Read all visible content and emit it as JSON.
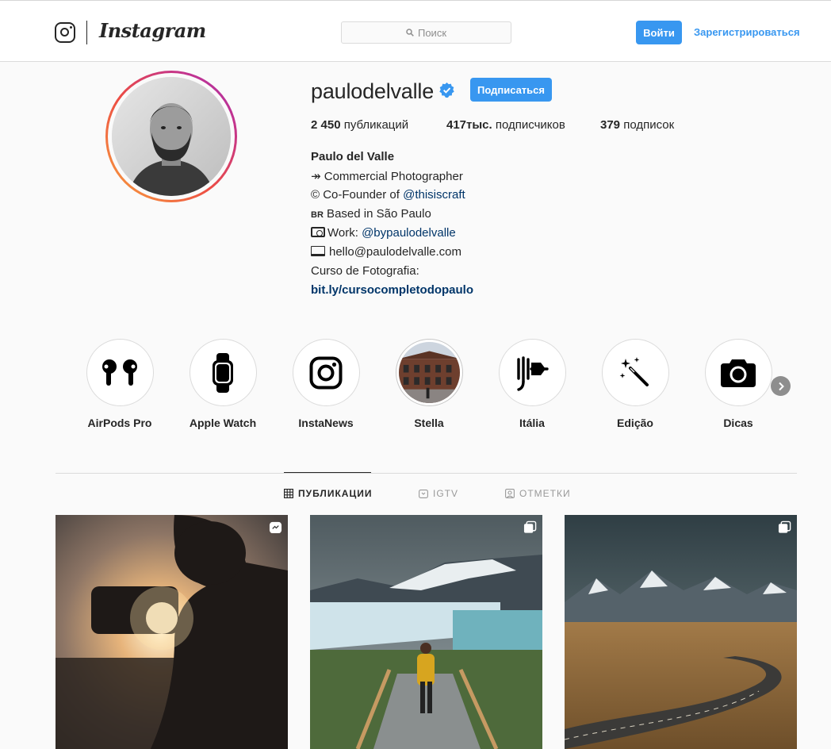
{
  "header": {
    "brand": "Instagram",
    "search_placeholder": "Поиск",
    "login_label": "Войти",
    "signup_label": "Зарегистрироваться"
  },
  "profile": {
    "username": "paulodelvalle",
    "follow_label": "Подписаться",
    "stats": [
      {
        "value": "2 450",
        "label": "публикаций"
      },
      {
        "value": "417тыс.",
        "label": "подписчиков"
      },
      {
        "value": "379",
        "label": "подписок"
      }
    ],
    "full_name": "Paulo del Valle",
    "bio": {
      "line1": "↠ Commercial Photographer",
      "line2_prefix": "© Co-Founder of ",
      "line2_link": "@thisiscraft",
      "line3_flag": "BR",
      "line3_text": " Based in São Paulo",
      "line4_prefix": "Work: ",
      "line4_link": "@bypaulodelvalle",
      "line5": "hello@paulodelvalle.com",
      "line6": "Curso de Fotografia:",
      "link": "bit.ly/cursocompletodopaulo"
    }
  },
  "highlights": [
    {
      "label": "AirPods Pro",
      "icon": "airpods-icon"
    },
    {
      "label": "Apple Watch",
      "icon": "apple-watch-icon"
    },
    {
      "label": "InstaNews",
      "icon": "instagram-icon"
    },
    {
      "label": "Stella",
      "icon": "building-photo"
    },
    {
      "label": "Itália",
      "icon": "italia-icon"
    },
    {
      "label": "Edição",
      "icon": "magic-wand-icon"
    },
    {
      "label": "Dicas",
      "icon": "camera-icon"
    }
  ],
  "tabs": [
    {
      "label": "ПУБЛИКАЦИИ",
      "icon": "grid-icon",
      "active": true
    },
    {
      "label": "IGTV",
      "icon": "igtv-icon",
      "active": false
    },
    {
      "label": "ОТМЕТКИ",
      "icon": "tagged-icon",
      "active": false
    }
  ],
  "posts": [
    {
      "badge": "igtv-icon"
    },
    {
      "badge": "carousel-icon"
    },
    {
      "badge": "carousel-icon"
    }
  ],
  "colors": {
    "accent": "#3897f0",
    "link_dark": "#003569",
    "text": "#262626",
    "muted": "#8e8e8e"
  }
}
